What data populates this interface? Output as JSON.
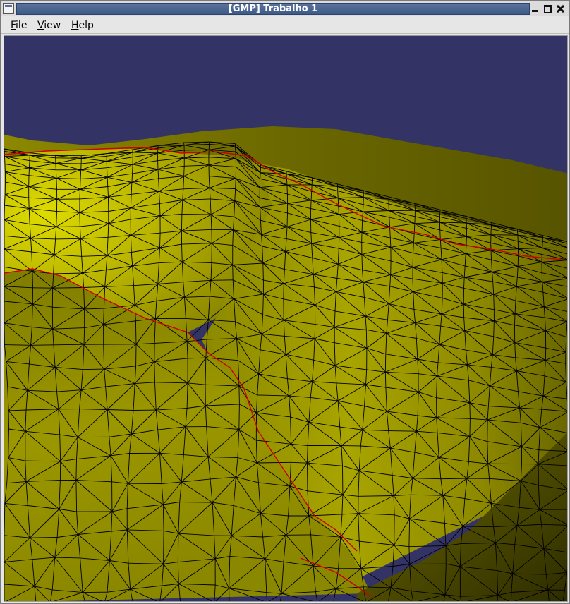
{
  "window": {
    "title": "[GMP] Trabalho 1",
    "controls": [
      "minimize-icon",
      "maximize-icon",
      "close-icon"
    ]
  },
  "menubar": {
    "items": [
      {
        "label": "File",
        "mnemonic": "F"
      },
      {
        "label": "View",
        "mnemonic": "V"
      },
      {
        "label": "Help",
        "mnemonic": "H"
      }
    ]
  },
  "viewport": {
    "content": "3D terrain triangle mesh",
    "colors": {
      "sky": "#333366",
      "terrain_light": "#d6d200",
      "terrain_mid": "#9a9600",
      "terrain_dark": "#3e3c00",
      "wireframe": "#000000",
      "edge_highlight": "#cc0000"
    }
  }
}
